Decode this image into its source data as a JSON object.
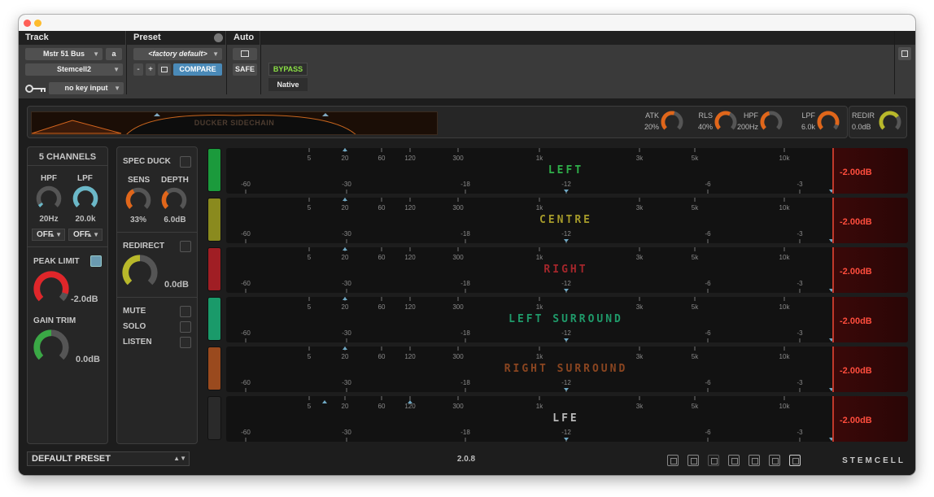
{
  "host": {
    "headers": {
      "track": "Track",
      "preset": "Preset",
      "auto": "Auto"
    },
    "track_name": "Mstr 51 Bus",
    "track_channel": "a",
    "plugin_name": "Stemcell2",
    "preset_name": "<factory default>",
    "preset_minus": "-",
    "preset_plus": "+",
    "compare_label": "COMPARE",
    "safe_label": "SAFE",
    "bypass_label": "BYPASS",
    "native_label": "Native",
    "key_input": "no key input"
  },
  "plugin": {
    "ducker_label": "DUCKER SIDECHAIN",
    "top_knobs": [
      {
        "name": "ATK",
        "value": "20%",
        "level": 0.55,
        "color": "#e0661a"
      },
      {
        "name": "RLS",
        "value": "40%",
        "level": 0.6,
        "color": "#e0661a"
      },
      {
        "name": "HPF",
        "value": "200Hz",
        "level": 0.45,
        "color": "#e0661a"
      },
      {
        "name": "LPF",
        "value": "6.0k",
        "level": 0.9,
        "color": "#e0661a"
      }
    ],
    "redir": {
      "name": "REDIR",
      "value": "0.0dB",
      "level": 0.7,
      "color": "#b8b82a"
    },
    "channels_title": "5 CHANNELS",
    "hpf": {
      "label": "HPF",
      "value": "20Hz",
      "level": 0.05,
      "color": "#6bb8c8",
      "mode": "OFF"
    },
    "lpf": {
      "label": "LPF",
      "value": "20.0k",
      "level": 1.0,
      "color": "#6bb8c8",
      "mode": "OFF"
    },
    "peak_limit": {
      "label": "PEAK LIMIT",
      "value": "-2.0dB",
      "level": 0.9,
      "color": "#e0262a"
    },
    "gain_trim": {
      "label": "GAIN TRIM",
      "value": "0.0dB",
      "level": 0.5,
      "color": "#3aa845"
    },
    "spec_duck": "SPEC DUCK",
    "sens": {
      "label": "SENS",
      "value": "33%",
      "level": 0.4,
      "color": "#e0661a"
    },
    "depth": {
      "label": "DEPTH",
      "value": "6.0dB",
      "level": 0.35,
      "color": "#e0661a"
    },
    "redirect": {
      "label": "REDIRECT",
      "value": "0.0dB",
      "level": 0.5,
      "color": "#b8b82a"
    },
    "mute": "MUTE",
    "solo": "SOLO",
    "listen": "LISTEN",
    "freq_ticks": [
      "5",
      "20",
      "60",
      "120",
      "300",
      "1k",
      "3k",
      "5k",
      "10k",
      "20k"
    ],
    "db_ticks": [
      "-60",
      "-30",
      "-18",
      "-12",
      "-6",
      "-3",
      "-1"
    ],
    "channels": [
      {
        "name": "LEFT",
        "color": "#1b9a3c",
        "text_color": "#2fb04a",
        "limit": "-2.00dB"
      },
      {
        "name": "CENTRE",
        "color": "#8a8a1e",
        "text_color": "#a59a2a",
        "limit": "-2.00dB"
      },
      {
        "name": "RIGHT",
        "color": "#a01e24",
        "text_color": "#a3262b",
        "limit": "-2.00dB"
      },
      {
        "name": "LEFT SURROUND",
        "color": "#1a9a6a",
        "text_color": "#1f9a6a",
        "limit": "-2.00dB"
      },
      {
        "name": "RIGHT SURROUND",
        "color": "#9a4a1e",
        "text_color": "#8a4520",
        "limit": "-2.00dB"
      },
      {
        "name": "LFE",
        "color": "#2a2a2a",
        "text_color": "#b8b8b8",
        "limit": "-2.00dB"
      }
    ],
    "default_preset": "DEFAULT PRESET",
    "version": "2.0.8",
    "brand": "STEMCELL"
  }
}
